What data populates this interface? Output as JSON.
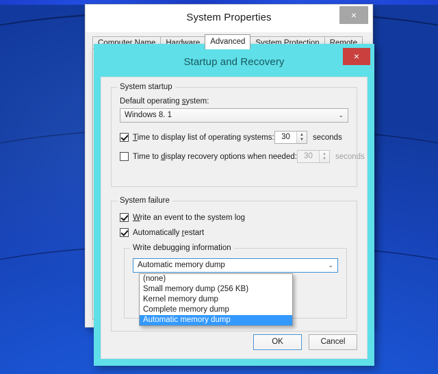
{
  "desktop": {
    "name": "windows-desktop-wallpaper"
  },
  "system_properties": {
    "title": "System Properties",
    "close_label": "×",
    "tabs": [
      {
        "label": "Computer Name",
        "selected": false
      },
      {
        "label": "Hardware",
        "selected": false
      },
      {
        "label": "Advanced",
        "selected": true
      },
      {
        "label": "System Protection",
        "selected": false
      },
      {
        "label": "Remote",
        "selected": false
      }
    ]
  },
  "startup_recovery": {
    "title": "Startup and Recovery",
    "close_label": "×",
    "system_startup": {
      "legend": "System startup",
      "default_os_label_pre": "Default operating ",
      "default_os_label_accel": "s",
      "default_os_label_post": "ystem:",
      "default_os_value": "Windows 8. 1",
      "combo_arrow": "⌄",
      "timeout_os": {
        "accel": "T",
        "label_rest": "ime to display list of operating systems:",
        "checked": true,
        "value": "30",
        "unit": "seconds",
        "enabled": true
      },
      "timeout_recovery": {
        "label_pre": "Time to ",
        "accel": "d",
        "label_post": "isplay recovery options when needed:",
        "checked": false,
        "value": "30",
        "unit": "seconds",
        "enabled": false
      }
    },
    "system_failure": {
      "legend": "System failure",
      "write_event": {
        "accel": "W",
        "label_rest": "rite an event to the system log",
        "checked": true
      },
      "auto_restart": {
        "label_pre": "Automatically ",
        "accel": "r",
        "label_post": "estart",
        "checked": true
      },
      "write_debugging": {
        "legend": "Write debugging information",
        "selected_value": "Automatic memory dump",
        "combo_arrow": "⌄",
        "options": [
          "(none)",
          "Small memory dump (256 KB)",
          "Kernel memory dump",
          "Complete memory dump",
          "Automatic memory dump"
        ],
        "selected_index": 4
      }
    },
    "buttons": {
      "ok": "OK",
      "cancel": "Cancel"
    }
  },
  "colors": {
    "dialog_accent": "#5fdfe8",
    "close_red": "#c9403f",
    "selection_blue": "#3399ff",
    "focus_border": "#3c8fd4",
    "desktop_blue": "#1a52cf"
  }
}
